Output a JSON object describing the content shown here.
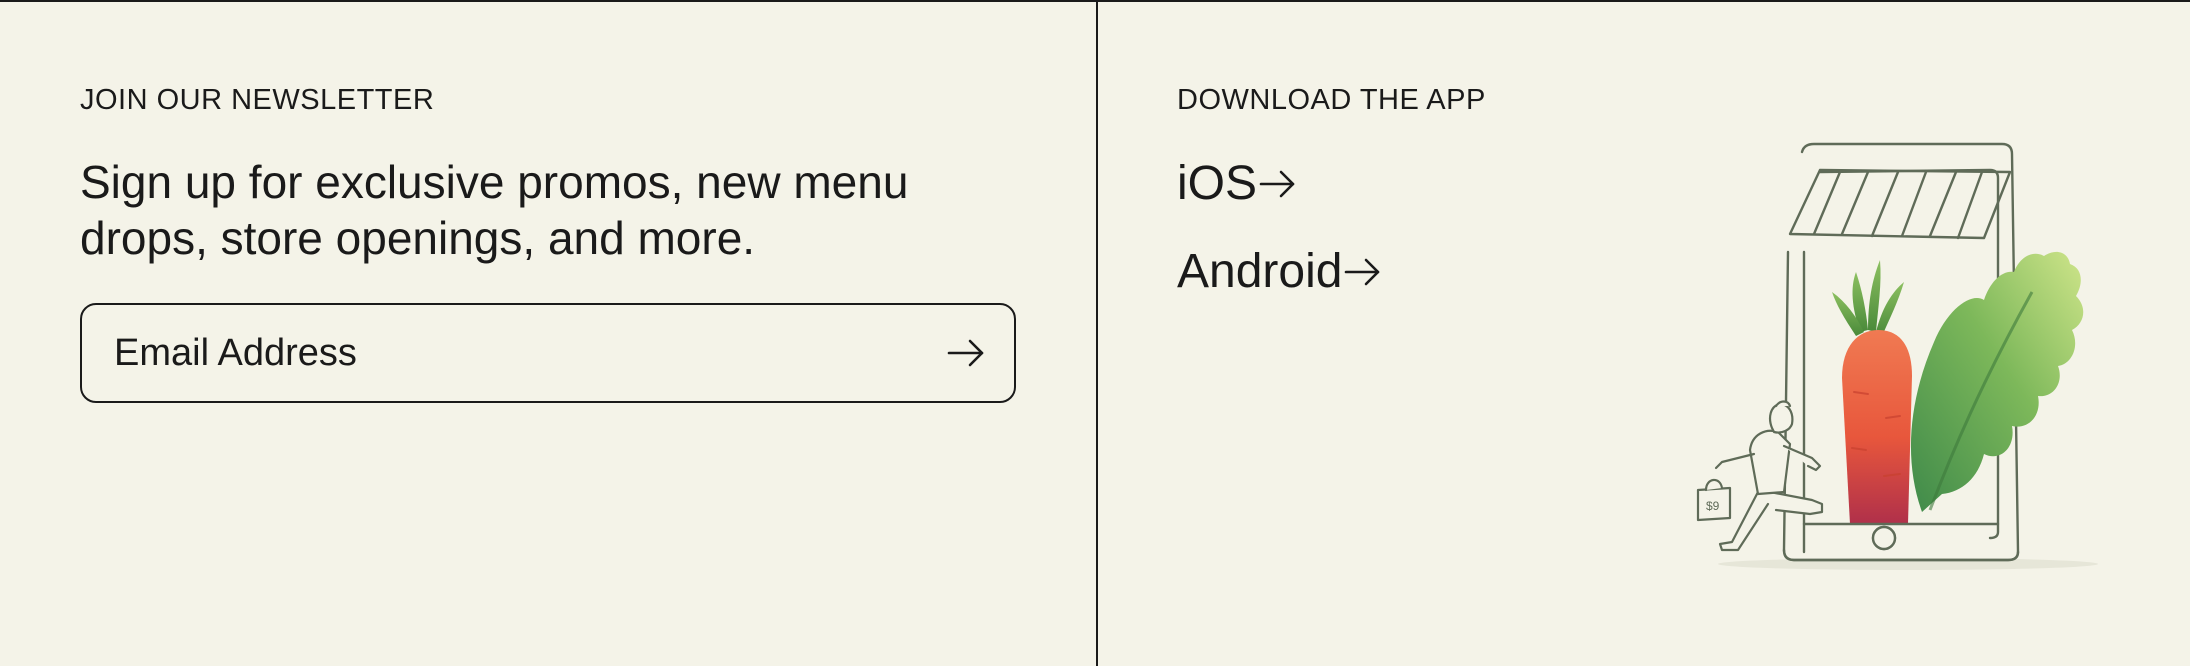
{
  "newsletter": {
    "eyebrow": "JOIN OUR NEWSLETTER",
    "headline": "Sign up for exclusive promos, new menu drops, store openings, and more.",
    "email_placeholder": "Email Address",
    "email_value": "",
    "submit_icon": "arrow-right-icon"
  },
  "app": {
    "eyebrow": "DOWNLOAD THE APP",
    "links": [
      {
        "label": "iOS",
        "icon": "arrow-right-icon"
      },
      {
        "label": "Android",
        "icon": "arrow-right-icon"
      }
    ],
    "illustration": {
      "bag_label": "$9",
      "subject": "person carrying bag walking out of phone with carrot and leafy green"
    }
  },
  "colors": {
    "background": "#f4f3e8",
    "text": "#1a1a1a",
    "line_art": "#5f6b58",
    "carrot": "#e8573c",
    "leaf": "#6fae4f"
  }
}
